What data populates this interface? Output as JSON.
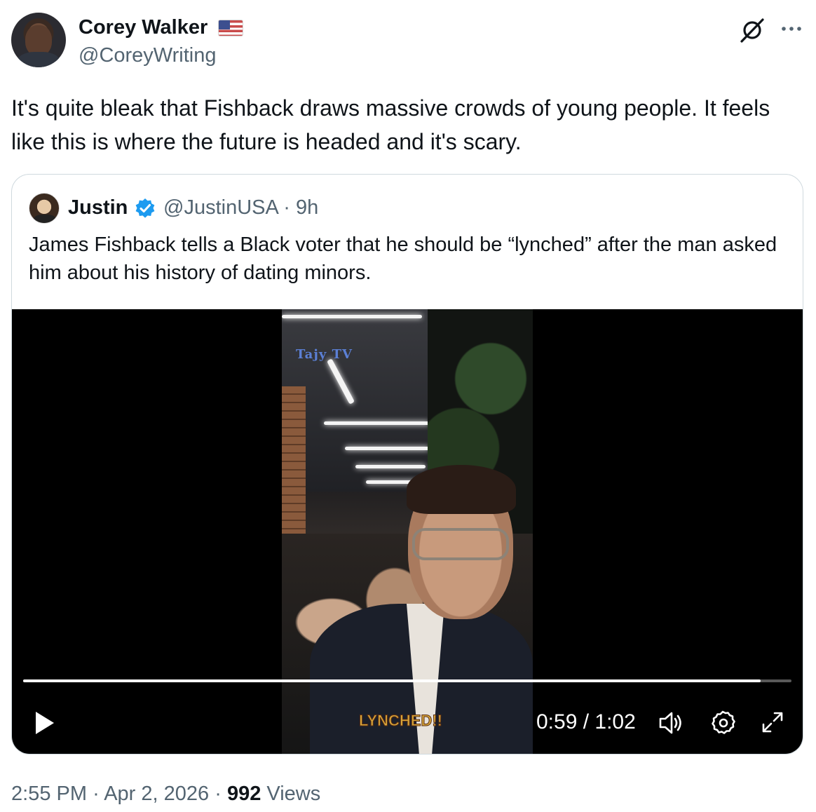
{
  "author": {
    "name": "Corey Walker",
    "handle": "@CoreyWriting",
    "flag_icon": "us-flag-icon"
  },
  "icons": {
    "grok": "grok-icon",
    "more": "more-icon"
  },
  "tweet": {
    "text": "It's quite bleak that Fishback draws massive crowds of young people. It feels like this is where the future is headed and it's scary."
  },
  "quote": {
    "name": "Justin",
    "verified": true,
    "verified_color": "#1d9bf0",
    "handle_time": "@JustinUSA · 9h",
    "text": "James Fishback tells a Black voter that he should be “lynched” after the man asked him about his history of dating minors."
  },
  "video": {
    "watermark": "Tajy TV",
    "caption": "LYNCHED!!",
    "time_display": "0:59 / 1:02",
    "progress_fraction": 0.96
  },
  "meta": {
    "time": "2:55 PM",
    "date": "Apr 2, 2026",
    "separator": "·",
    "views_count": "992",
    "views_label": "Views"
  }
}
